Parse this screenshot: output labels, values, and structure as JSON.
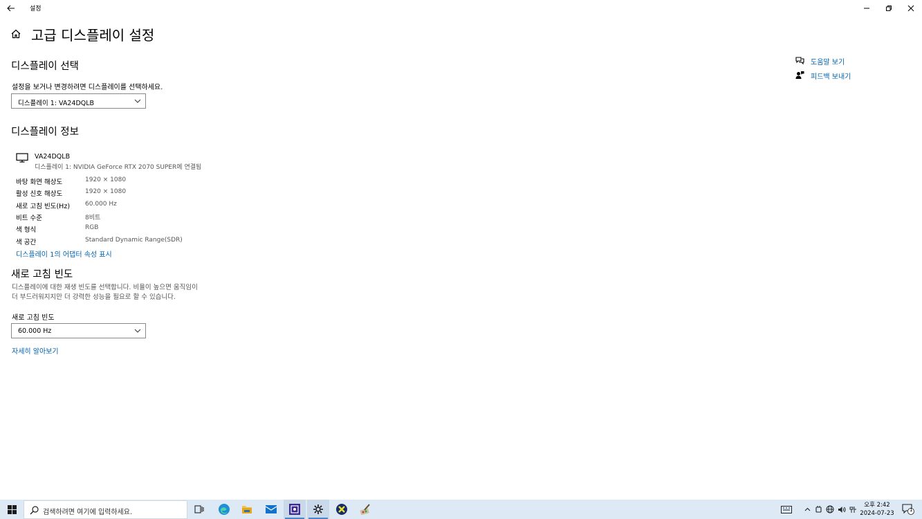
{
  "window": {
    "title": "설정"
  },
  "page": {
    "title": "고급 디스플레이 설정"
  },
  "select_display": {
    "heading": "디스플레이 선택",
    "description": "설정을 보거나 변경하려면 디스플레이를 선택하세요.",
    "selected": "디스플레이 1: VA24DQLB"
  },
  "display_info": {
    "heading": "디스플레이 정보",
    "monitor_name": "VA24DQLB",
    "monitor_sub": "디스플레이 1: NVIDIA GeForce RTX 2070 SUPER에 연결됨",
    "rows": [
      {
        "label": "바탕 화면 해상도",
        "value": "1920 × 1080"
      },
      {
        "label": "활성 신호 해상도",
        "value": "1920 × 1080"
      },
      {
        "label": "새로 고침 빈도(Hz)",
        "value": "60.000 Hz"
      },
      {
        "label": "비트 수준",
        "value": "8비트"
      },
      {
        "label": "색 형식",
        "value": "RGB"
      },
      {
        "label": "색 공간",
        "value": "Standard Dynamic Range(SDR)"
      }
    ],
    "adapter_link": "디스플레이 1의 어댑터 속성 표시"
  },
  "refresh_rate": {
    "heading": "새로 고침 빈도",
    "description_line1": "디스플레이에 대한 재생 빈도를 선택합니다. 비율이 높으면 움직임이",
    "description_line2": "더 부드러워지지만 더 강력한 성능을 필요로 할 수 있습니다.",
    "field_label": "새로 고침 빈도",
    "selected": "60.000 Hz",
    "learn_more": "자세히 알아보기"
  },
  "side_links": {
    "help": "도움말 보기",
    "feedback": "피드백 보내기"
  },
  "taskbar": {
    "search_placeholder": "검색하려면 여기에 입력하세요.",
    "clock_time": "오후 2:42",
    "clock_date": "2024-07-23",
    "notification_count": "1"
  },
  "colors": {
    "link": "#0063b1",
    "taskbar": "#dde9f5"
  }
}
